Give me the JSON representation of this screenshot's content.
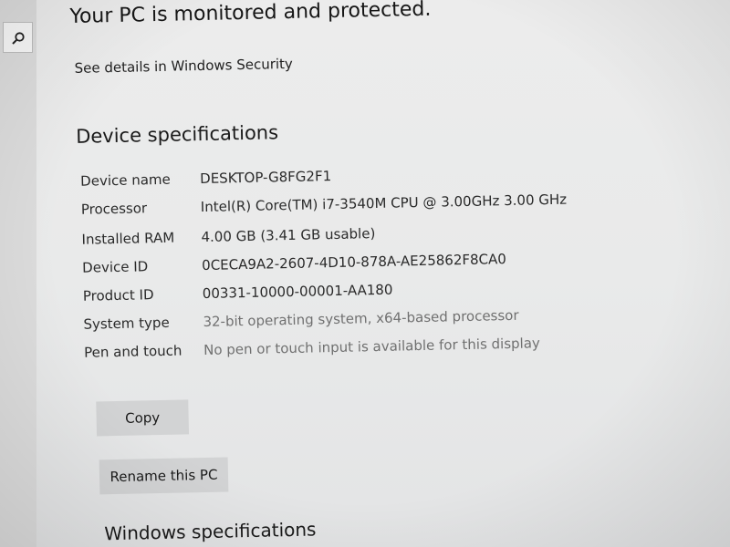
{
  "header": {
    "monitored_title": "Your PC is monitored and protected.",
    "security_link": "See details in Windows Security"
  },
  "device_specs": {
    "title": "Device specifications",
    "rows": [
      {
        "label": "Device name",
        "value": "DESKTOP-G8FG2F1"
      },
      {
        "label": "Processor",
        "value": "Intel(R) Core(TM) i7-3540M CPU @ 3.00GHz   3.00 GHz"
      },
      {
        "label": "Installed RAM",
        "value": "4.00 GB (3.41 GB usable)"
      },
      {
        "label": "Device ID",
        "value": "0CECA9A2-2607-4D10-878A-AE25862F8CA0"
      },
      {
        "label": "Product ID",
        "value": "00331-10000-00001-AA180"
      },
      {
        "label": "System type",
        "value": "32-bit operating system, x64-based processor"
      },
      {
        "label": "Pen and touch",
        "value": "No pen or touch input is available for this display"
      }
    ],
    "copy_label": "Copy",
    "rename_label": "Rename this PC"
  },
  "windows_specs": {
    "title": "Windows specifications"
  },
  "icons": {
    "search": "search-icon"
  }
}
